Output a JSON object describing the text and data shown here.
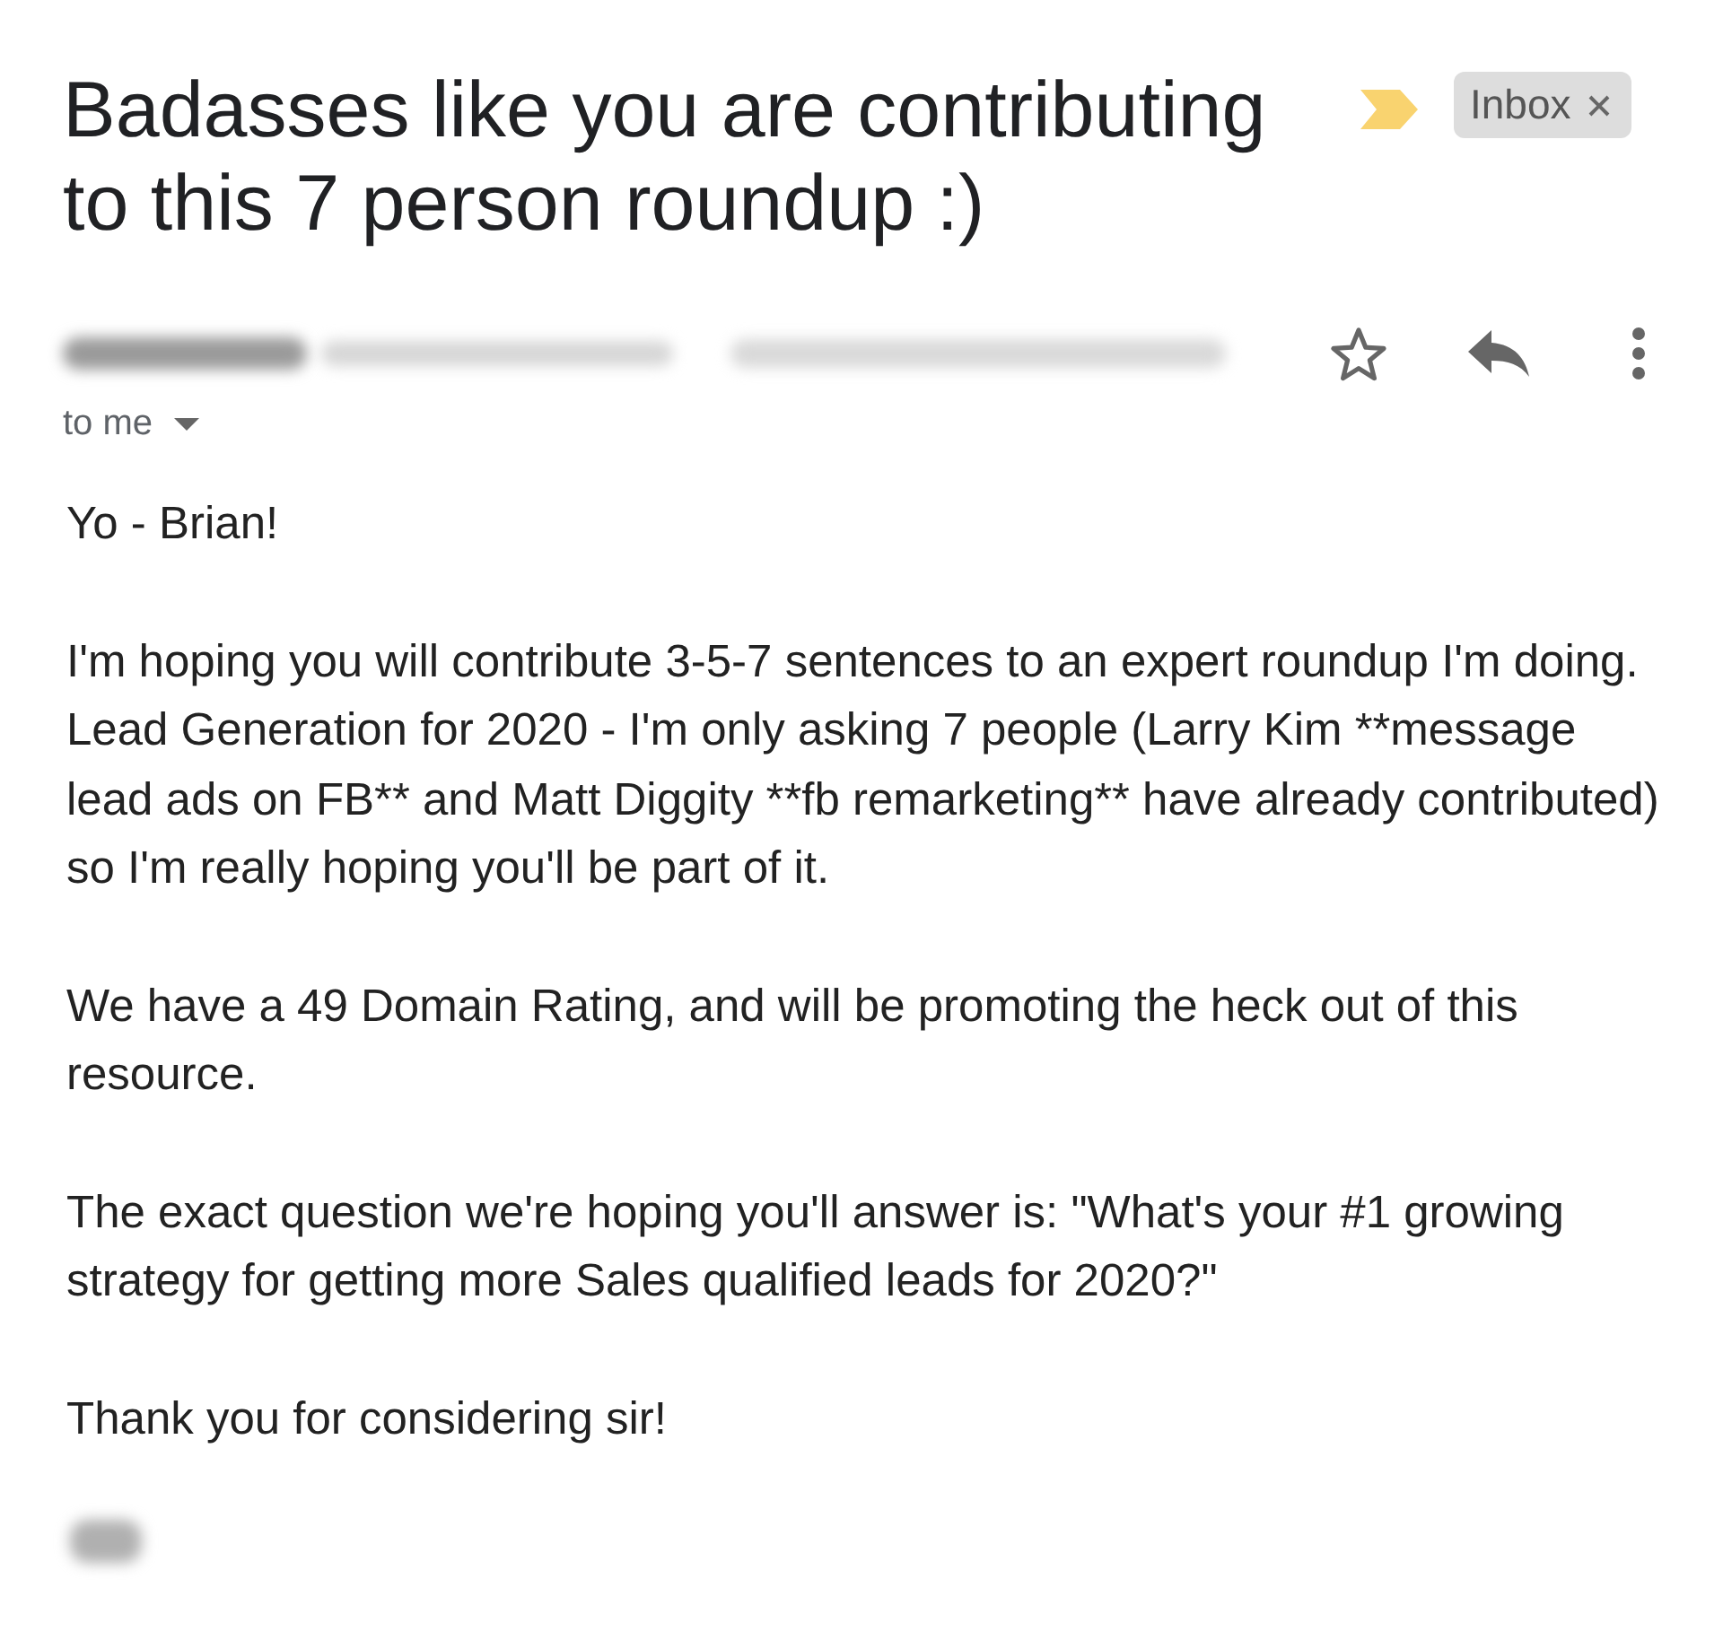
{
  "subject": {
    "text": "Badasses like you are contributing to this 7 person roundup :)",
    "important": true,
    "labels": [
      {
        "text": "Inbox",
        "removable": true
      }
    ]
  },
  "header": {
    "sender_redacted": true,
    "date_redacted": true,
    "starred": false,
    "recipients": "to me",
    "recipients_expandable": true
  },
  "body": {
    "paragraphs": [
      "Yo - Brian!",
      "I'm hoping you will contribute 3-5-7 sentences to an expert roundup I'm doing. Lead Generation for 2020 - I'm only asking 7 people (Larry Kim **message lead ads on FB** and Matt Diggity **fb remarketing** have already contributed) so I'm really hoping you'll be part of it.",
      "We have a 49 Domain Rating, and will be promoting the heck out of this resource.",
      "The exact question we're hoping you'll answer is: \"What's your #1 growing strategy for getting more Sales qualified leads for 2020?\"",
      "Thank you for considering sir!"
    ],
    "signature_redacted": true
  }
}
